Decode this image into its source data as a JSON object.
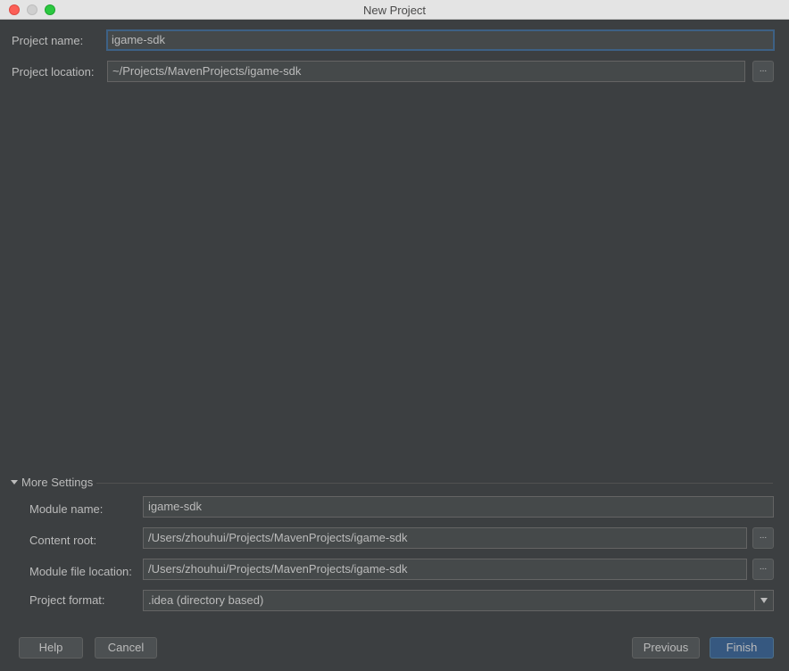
{
  "window": {
    "title": "New Project"
  },
  "form": {
    "project_name_label": "Project name:",
    "project_name_value": "igame-sdk",
    "project_location_label": "Project location:",
    "project_location_value": "~/Projects/MavenProjects/igame-sdk",
    "browse_label": "..."
  },
  "more_settings": {
    "title": "More Settings",
    "module_name_label": "Module name:",
    "module_name_value": "igame-sdk",
    "content_root_label": "Content root:",
    "content_root_value": "/Users/zhouhui/Projects/MavenProjects/igame-sdk",
    "module_file_location_label": "Module file location:",
    "module_file_location_value": "/Users/zhouhui/Projects/MavenProjects/igame-sdk",
    "project_format_label": "Project format:",
    "project_format_value": ".idea (directory based)"
  },
  "buttons": {
    "help": "Help",
    "cancel": "Cancel",
    "previous": "Previous",
    "finish": "Finish"
  }
}
